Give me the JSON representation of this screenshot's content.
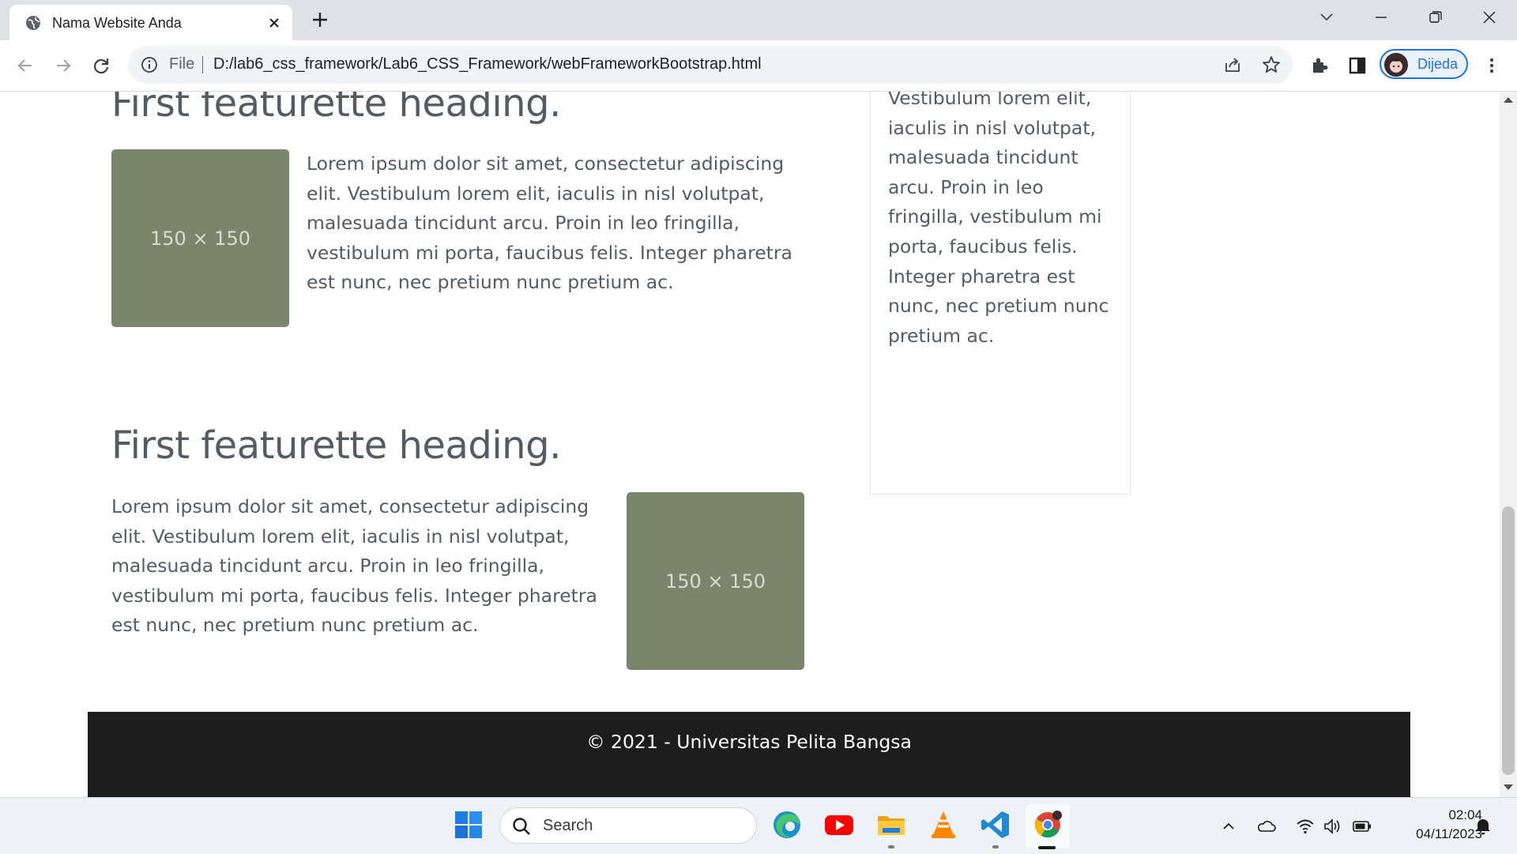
{
  "browser": {
    "tab_title": "Nama Website Anda",
    "omnibox_scheme": "File",
    "url": "D:/lab6_css_framework/Lab6_CSS_Framework/webFrameworkBootstrap.html",
    "profile_name": "Dijeda"
  },
  "page": {
    "featurette_1": {
      "heading": "First featurette heading.",
      "text": "Lorem ipsum dolor sit amet, consectetur adipiscing elit. Vestibulum lorem elit, iaculis in nisl volutpat, malesuada tincidunt arcu. Proin in leo fringilla, vestibulum mi porta, faucibus felis. Integer pharetra est nunc, nec pretium nunc pretium ac.",
      "image_label": "150 × 150"
    },
    "sidebar_text": "Vestibulum lorem elit, iaculis in nisl volutpat, malesuada tincidunt arcu. Proin in leo fringilla, vestibulum mi porta, faucibus felis. Integer pharetra est nunc, nec pretium nunc pretium ac.",
    "featurette_2": {
      "heading": "First featurette heading.",
      "text": "Lorem ipsum dolor sit amet, consectetur adipiscing elit. Vestibulum lorem elit, iaculis in nisl volutpat, malesuada tincidunt arcu. Proin in leo fringilla, vestibulum mi porta, faucibus felis. Integer pharetra est nunc, nec pretium nunc pretium ac.",
      "image_label": "150 × 150"
    },
    "footer_text": "© 2021 - Universitas Pelita Bangsa",
    "colors": {
      "placeholder": "#7a866c",
      "footer_bg": "#1d1d1d",
      "text": "#545b62"
    }
  },
  "taskbar": {
    "search_label": "Search",
    "time": "02:04",
    "date": "04/11/2023",
    "apps": [
      "start-icon",
      "edge-icon",
      "youtube-icon",
      "file-explorer-icon",
      "vlc-icon",
      "vscode-icon",
      "chrome-icon"
    ]
  }
}
